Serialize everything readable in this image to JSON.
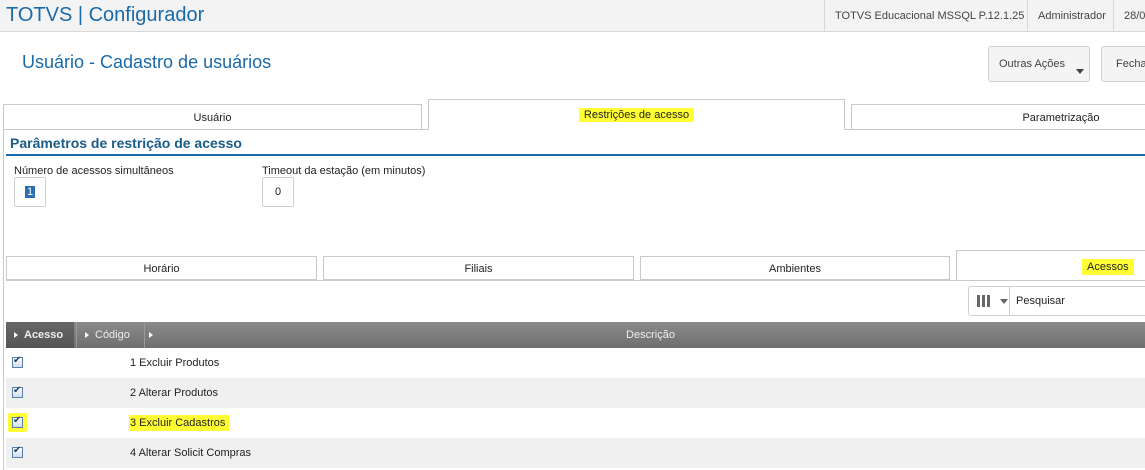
{
  "topbar": {
    "brand": "TOTVS | Configurador",
    "environment": "TOTVS Educacional MSSQL P.12.1.25",
    "user": "Administrador",
    "date": "28/0"
  },
  "page": {
    "title": "Usuário - Cadastro de usuários",
    "outras_acoes_label": "Outras Ações",
    "fechar_label": "Fecha"
  },
  "tabs": [
    {
      "label": "Usuário"
    },
    {
      "label": "Restrições de acesso",
      "active": true
    },
    {
      "label": "Parametrização"
    }
  ],
  "section": {
    "title": "Parâmetros de restrição de acesso",
    "num_acessos_label": "Número de acessos simultâneos",
    "num_acessos_value": "1",
    "timeout_label": "Timeout da estação (em minutos)",
    "timeout_value": "0"
  },
  "subtabs": [
    {
      "label": "Horário"
    },
    {
      "label": "Filiais"
    },
    {
      "label": "Ambientes"
    },
    {
      "label": "Acessos",
      "active": true
    }
  ],
  "search": {
    "placeholder": "Pesquisar"
  },
  "grid": {
    "columns": {
      "acesso": "Acesso",
      "codigo": "Código",
      "descricao": "Descrição"
    },
    "rows": [
      {
        "checked": true,
        "text": "1  Excluir Produtos"
      },
      {
        "checked": true,
        "text": "2  Alterar Produtos"
      },
      {
        "checked": true,
        "text": "3  Excluir Cadastros",
        "highlight": true
      },
      {
        "checked": true,
        "text": "4  Alterar Solicit Compras"
      }
    ]
  },
  "colors": {
    "brand_blue": "#1a6aa8",
    "highlight_yellow": "#ffff33",
    "grid_header": "#7a7a7a"
  }
}
